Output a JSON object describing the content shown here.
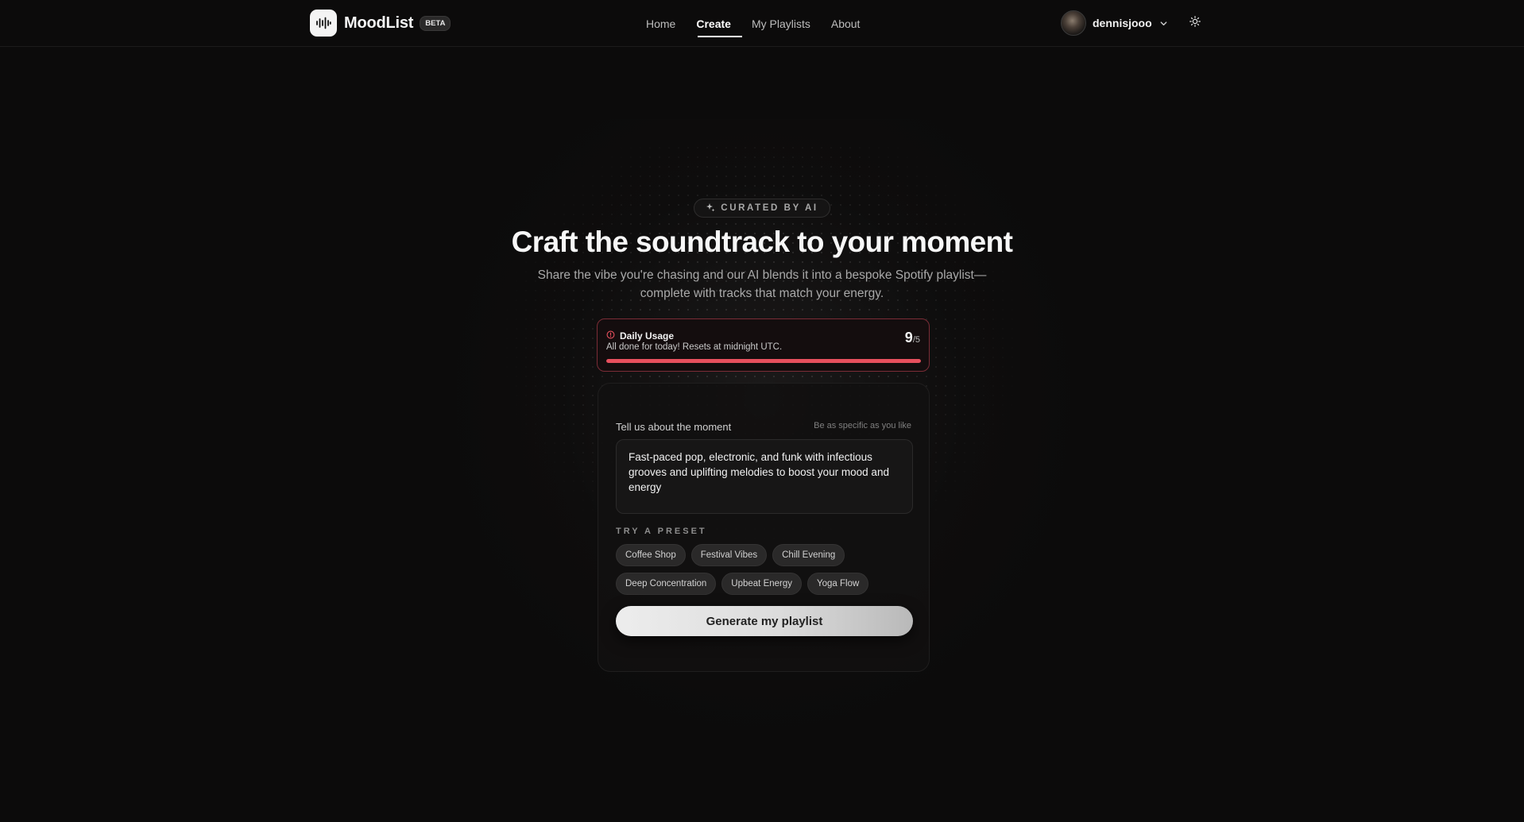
{
  "header": {
    "brand": "MoodList",
    "badge": "BETA",
    "nav": [
      {
        "label": "Home"
      },
      {
        "label": "Create"
      },
      {
        "label": "My Playlists"
      },
      {
        "label": "About"
      }
    ],
    "active_nav": "Create",
    "user": {
      "name": "dennisjooo"
    }
  },
  "hero": {
    "pill": "CURATED BY AI",
    "title": "Craft the soundtrack to your moment",
    "subtitle": "Share the vibe you're chasing and our AI blends it into a bespoke Spotify playlist—complete with tracks that match your energy."
  },
  "usage": {
    "title": "Daily Usage",
    "message": "All done for today! Resets at midnight UTC.",
    "used": "9",
    "limit": "/5",
    "progress_fraction": 1.0,
    "accent": "#e8505e"
  },
  "form": {
    "label": "Tell us about the moment",
    "hint": "Be as specific as you like",
    "value": "Fast-paced pop, electronic, and funk with infectious grooves and uplifting melodies to boost your mood and energy",
    "preset_heading": "TRY A PRESET",
    "presets": [
      "Coffee Shop",
      "Festival Vibes",
      "Chill Evening",
      "Deep Concentration",
      "Upbeat Energy",
      "Yoga Flow"
    ],
    "submit": "Generate my playlist"
  },
  "icons": {
    "logo": "audio-waveform-icon",
    "user_menu": "chevron-down-icon",
    "theme": "sun-icon",
    "pill": "sparkles-icon",
    "usage": "alert-circle-icon"
  }
}
